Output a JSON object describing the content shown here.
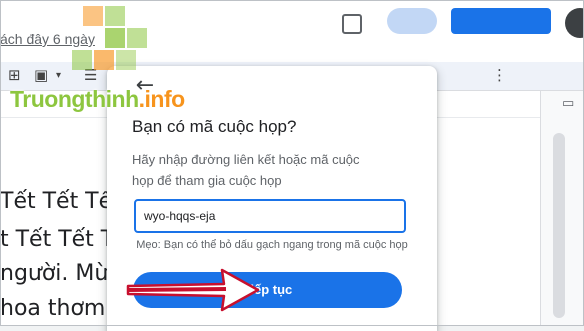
{
  "header": {
    "last_edit": "ách đây 6 ngày"
  },
  "document": {
    "lines": [
      "Tết Tết Tết đến",
      "t Tết Tết Tết T",
      "người. Mừn",
      "hoa thơm"
    ]
  },
  "watermark": {
    "brand_main": "Truongthinh",
    "brand_suffix": ".info",
    "colors": {
      "green": "#8dc63f",
      "orange": "#f7941d"
    }
  },
  "dialog": {
    "back_icon": "arrow-left-icon",
    "title": "Bạn có mã cuộc họp?",
    "description": "Hãy nhập đường liên kết hoặc mã cuộc họp để tham gia cuộc họp",
    "input_value": "wyo-hqqs-eja",
    "hint": "Mẹo: Bạn có thể bỏ dấu gạch ngang trong mã cuộc họp",
    "continue_label": "Tiếp tục"
  },
  "colors": {
    "accent": "#1a73e8",
    "annotation_arrow": "#c8102e"
  }
}
